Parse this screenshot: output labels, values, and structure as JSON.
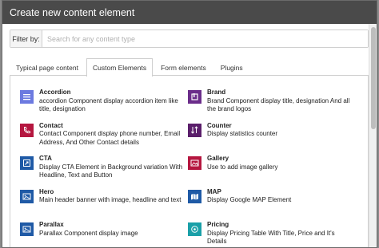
{
  "modal": {
    "title": "Create new content element"
  },
  "filter": {
    "label": "Filter by:",
    "placeholder": "Search for any content type"
  },
  "tabs": [
    "Typical page content",
    "Custom Elements",
    "Form elements",
    "Plugins"
  ],
  "items": [
    {
      "title": "Accordion",
      "desc": "accordion Component display accordion item like title, designation",
      "icon": "list-icon",
      "color": "#6c7ae0"
    },
    {
      "title": "Brand",
      "desc": "Brand Component display title, designation And all the brand logos",
      "icon": "brand-icon",
      "color": "#6b2d8a"
    },
    {
      "title": "Contact",
      "desc": "Contact Component display phone number, Email Address, And Other Contact details",
      "icon": "phone-icon",
      "color": "#b5163f"
    },
    {
      "title": "Counter",
      "desc": "Display statistics counter",
      "icon": "sort-icon",
      "color": "#5b1f6b"
    },
    {
      "title": "CTA",
      "desc": "Display CTA Element in Background variation With Headline, Text and Button",
      "icon": "cta-icon",
      "color": "#1f5aa6"
    },
    {
      "title": "Gallery",
      "desc": "Use to add image gallery",
      "icon": "gallery-icon",
      "color": "#b5163f"
    },
    {
      "title": "Hero",
      "desc": "Main header banner with image, headline and text",
      "icon": "image-icon",
      "color": "#1f5aa6"
    },
    {
      "title": "MAP",
      "desc": "Display Google MAP Element",
      "icon": "map-icon",
      "color": "#1f5aa6"
    },
    {
      "title": "Parallax",
      "desc": "Parallax Component display image",
      "icon": "image-icon",
      "color": "#1f5aa6"
    },
    {
      "title": "Pricing",
      "desc": "Display Pricing Table With Title, Price and It's Details",
      "icon": "pricing-icon",
      "color": "#1aa0a8"
    }
  ]
}
